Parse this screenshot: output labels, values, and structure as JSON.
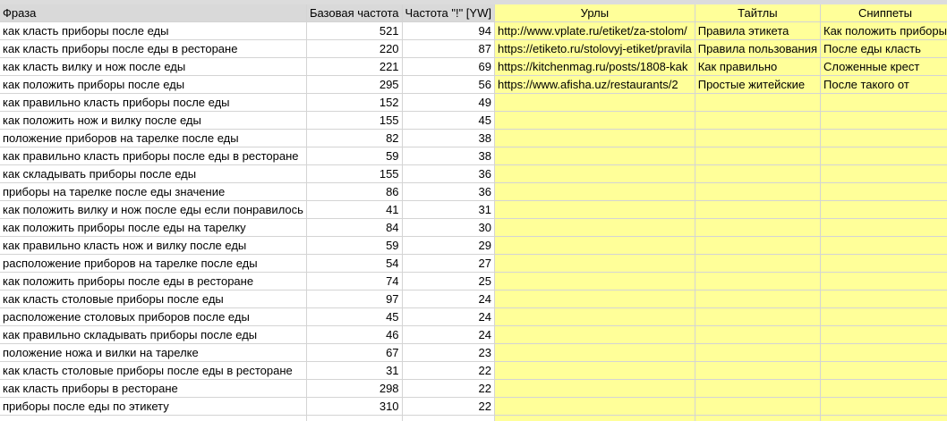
{
  "sheet": {
    "headers": [
      "Фраза",
      "Базовая частота",
      "Частота \"!\" [YW]",
      "Урлы",
      "Тайтлы",
      "Сниппеты"
    ],
    "rows": [
      {
        "phrase": "как класть приборы после еды",
        "base": "521",
        "freq": "94",
        "url": "http://www.vplate.ru/etiket/za-stolom/",
        "title": "Правила этикета",
        "snippet": "Как положить приборы"
      },
      {
        "phrase": "как класть приборы после еды в ресторане",
        "base": "220",
        "freq": "87",
        "url": "https://etiketo.ru/stolovyj-etiket/pravila",
        "title": "Правила пользования",
        "snippet": "После еды класть"
      },
      {
        "phrase": "как класть вилку и нож после еды",
        "base": "221",
        "freq": "69",
        "url": "https://kitchenmag.ru/posts/1808-kak",
        "title": "Как правильно",
        "snippet": "Сложенные крест"
      },
      {
        "phrase": "как положить приборы после еды",
        "base": "295",
        "freq": "56",
        "url": "https://www.afisha.uz/restaurants/2",
        "title": "Простые житейские",
        "snippet": "После такого от"
      },
      {
        "phrase": "как правильно класть приборы после еды",
        "base": "152",
        "freq": "49",
        "url": "",
        "title": "",
        "snippet": ""
      },
      {
        "phrase": "как положить нож и вилку после еды",
        "base": "155",
        "freq": "45",
        "url": "",
        "title": "",
        "snippet": ""
      },
      {
        "phrase": "положение приборов на тарелке после еды",
        "base": "82",
        "freq": "38",
        "url": "",
        "title": "",
        "snippet": ""
      },
      {
        "phrase": "как правильно класть приборы после еды в ресторане",
        "base": "59",
        "freq": "38",
        "url": "",
        "title": "",
        "snippet": ""
      },
      {
        "phrase": "как складывать приборы после еды",
        "base": "155",
        "freq": "36",
        "url": "",
        "title": "",
        "snippet": ""
      },
      {
        "phrase": "приборы на тарелке после еды значение",
        "base": "86",
        "freq": "36",
        "url": "",
        "title": "",
        "snippet": ""
      },
      {
        "phrase": "как положить вилку и нож после еды если понравилось",
        "base": "41",
        "freq": "31",
        "url": "",
        "title": "",
        "snippet": ""
      },
      {
        "phrase": "как положить приборы после еды на тарелку",
        "base": "84",
        "freq": "30",
        "url": "",
        "title": "",
        "snippet": ""
      },
      {
        "phrase": "как правильно класть нож и вилку после еды",
        "base": "59",
        "freq": "29",
        "url": "",
        "title": "",
        "snippet": ""
      },
      {
        "phrase": "расположение приборов на тарелке после еды",
        "base": "54",
        "freq": "27",
        "url": "",
        "title": "",
        "snippet": ""
      },
      {
        "phrase": "как положить приборы после еды в ресторане",
        "base": "74",
        "freq": "25",
        "url": "",
        "title": "",
        "snippet": ""
      },
      {
        "phrase": "как класть столовые приборы после еды",
        "base": "97",
        "freq": "24",
        "url": "",
        "title": "",
        "snippet": ""
      },
      {
        "phrase": "расположение столовых приборов после еды",
        "base": "45",
        "freq": "24",
        "url": "",
        "title": "",
        "snippet": ""
      },
      {
        "phrase": "как правильно складывать приборы после еды",
        "base": "46",
        "freq": "24",
        "url": "",
        "title": "",
        "snippet": ""
      },
      {
        "phrase": "положение ножа и вилки на тарелке",
        "base": "67",
        "freq": "23",
        "url": "",
        "title": "",
        "snippet": ""
      },
      {
        "phrase": "как класть столовые приборы после еды в ресторане",
        "base": "31",
        "freq": "22",
        "url": "",
        "title": "",
        "snippet": ""
      },
      {
        "phrase": "как класть приборы в ресторане",
        "base": "298",
        "freq": "22",
        "url": "",
        "title": "",
        "snippet": ""
      },
      {
        "phrase": "приборы после еды по этикету",
        "base": "310",
        "freq": "22",
        "url": "",
        "title": "",
        "snippet": ""
      },
      {
        "phrase": "",
        "base": "",
        "freq": "",
        "url": "",
        "title": "",
        "snippet": ""
      }
    ],
    "highlight_color": "#ffff99",
    "header_color": "#d9d9d9"
  }
}
